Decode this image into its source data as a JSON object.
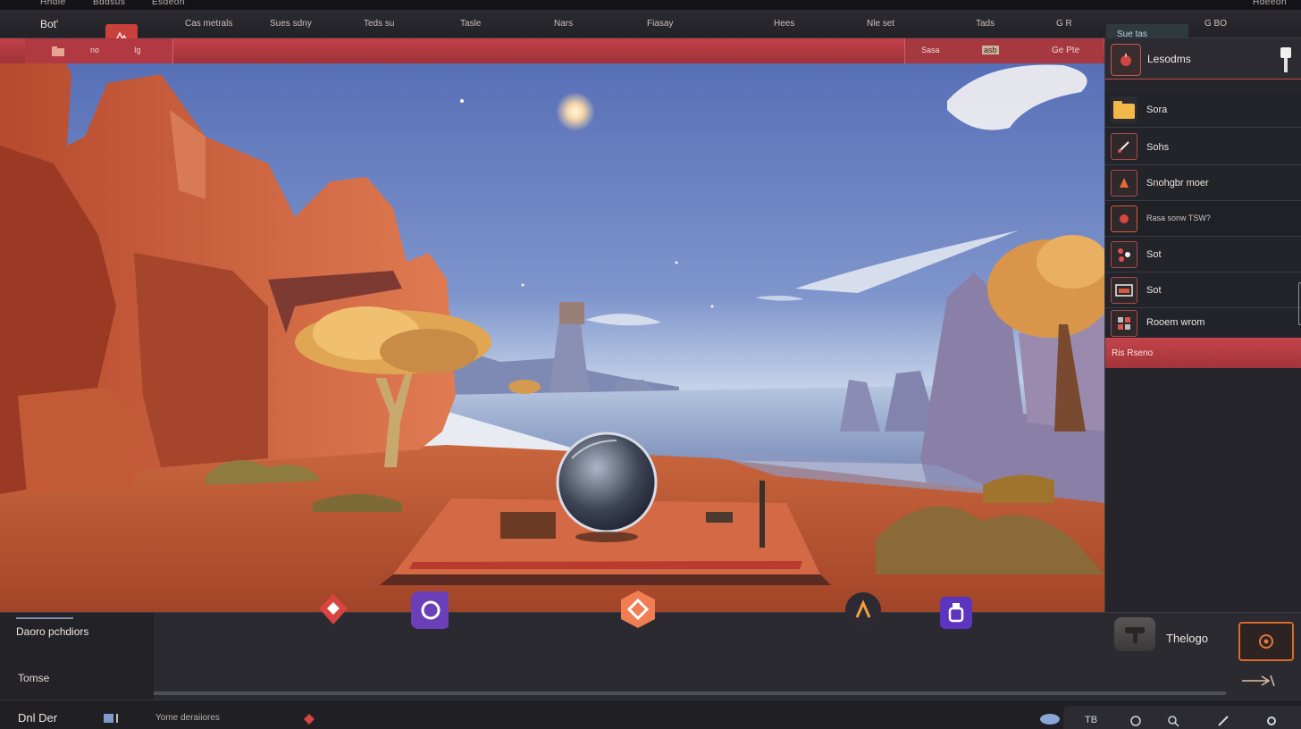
{
  "titlebar": {
    "items": [
      "Hhdie",
      "Bddsus",
      "Esdeon"
    ],
    "right_label": "Hdeeon"
  },
  "menubar": {
    "app_title": "Bot'",
    "items": [
      "Cas metrals",
      "Sues sdny",
      "Teds su",
      "Tasle",
      "Nars",
      "Fiasay",
      "Hees",
      "Nle set",
      "Tads",
      "G R"
    ],
    "right_tab": "Sue tas",
    "far_right": "G BO"
  },
  "viewport_toolbar": {
    "left_items": [
      "no",
      "Ig"
    ],
    "right_items": [
      "Sasa",
      "asb"
    ],
    "right_labels": "Ge Pte"
  },
  "right_panel": {
    "header_label": "Lesodms",
    "rows": [
      {
        "label": "Sora",
        "icon": "folder-icon"
      },
      {
        "label": "Sohs",
        "icon": "brush-icon"
      },
      {
        "label": "Snohgbr moer",
        "icon": "paint-bucket-icon"
      },
      {
        "label": "Rasa sonw  TSW?",
        "icon": "sprite-icon"
      },
      {
        "label": "Sot",
        "icon": "node-tree-icon"
      },
      {
        "label": "Sot",
        "icon": "image-icon"
      },
      {
        "label": "Rooem wrom",
        "icon": "grid-icon"
      }
    ],
    "active_item": "Ris Rseno"
  },
  "dock": {
    "title": "Daoro pchdiors",
    "subtitle": "Tomse",
    "logo_label": "Thelogo",
    "hud_buttons": [
      {
        "name": "gem-button",
        "color": "#d8443f"
      },
      {
        "name": "shield-button",
        "color": "#6a3fb8"
      },
      {
        "name": "target-button",
        "color": "#f07e52"
      },
      {
        "name": "tools-button",
        "color": "#2e2a33"
      },
      {
        "name": "potion-button",
        "color": "#5b34c0"
      }
    ]
  },
  "statusbar": {
    "left_text": "Dnl Der",
    "mid_text": "Yome deraiiores",
    "right_icons": [
      "TB",
      "chat-icon",
      "search-icon",
      "edit-icon",
      "settings-icon"
    ]
  },
  "colors": {
    "accent": "#c3424a",
    "panel_bg": "#25252b",
    "orange": "#d96a2a"
  }
}
